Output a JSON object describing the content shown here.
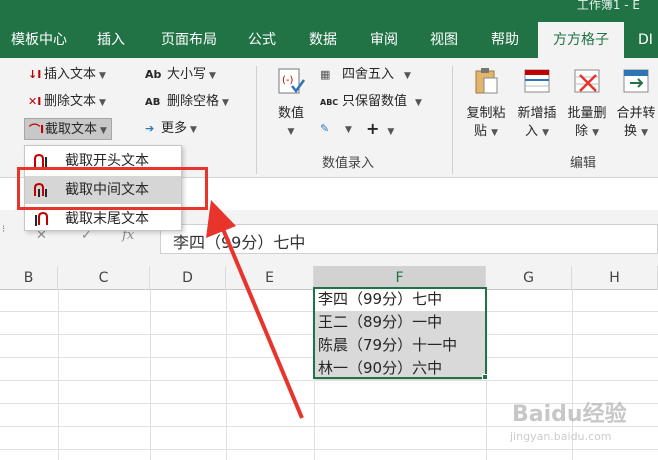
{
  "window": {
    "title": "工作簿1 - E"
  },
  "tabs": [
    {
      "label": "模板中心"
    },
    {
      "label": "插入"
    },
    {
      "label": "页面布局"
    },
    {
      "label": "公式"
    },
    {
      "label": "数据"
    },
    {
      "label": "审阅"
    },
    {
      "label": "视图"
    },
    {
      "label": "帮助"
    },
    {
      "label": "方方格子"
    },
    {
      "label": "DI"
    }
  ],
  "ribbon": {
    "text_group": {
      "insert_text": "插入文本",
      "delete_text": "删除文本",
      "extract_text": "截取文本",
      "case": "大小写",
      "case_icon": "Ab",
      "delete_space": "删除空格",
      "delete_space_icon": "AB",
      "more": "更多"
    },
    "numeric_group": {
      "value_label": "数值",
      "round": "四舍五入",
      "keep_numeric": "只保留数值",
      "keep_icon": "ABC",
      "plus_icon": "+",
      "group_label": "数值录入"
    },
    "edit_group": {
      "copy_paste_1": "复制粘",
      "copy_paste_2": "贴",
      "insert_new_1": "新增插",
      "insert_new_2": "入",
      "batch_delete_1": "批量删",
      "batch_delete_2": "除",
      "merge_1": "合并转",
      "merge_2": "换",
      "group_label": "编辑"
    }
  },
  "dropdown": {
    "items": [
      {
        "label": "截取开头文本"
      },
      {
        "label": "截取中间文本"
      },
      {
        "label": "截取末尾文本"
      }
    ]
  },
  "formula_bar": {
    "cancel": "✕",
    "confirm": "✓",
    "fx": "fx",
    "value": "李四（99分）七中"
  },
  "grid": {
    "columns": [
      "B",
      "C",
      "D",
      "E",
      "F",
      "G",
      "H"
    ],
    "cells": [
      "李四（99分）七中",
      "王二（89分）一中",
      "陈晨（79分）十一中",
      "林一（90分）六中"
    ]
  },
  "watermark": {
    "brand": "Baidu经验",
    "url": "jingyan.baidu.com"
  },
  "colors": {
    "excel_green": "#217346",
    "highlight_red": "#e8352c"
  }
}
